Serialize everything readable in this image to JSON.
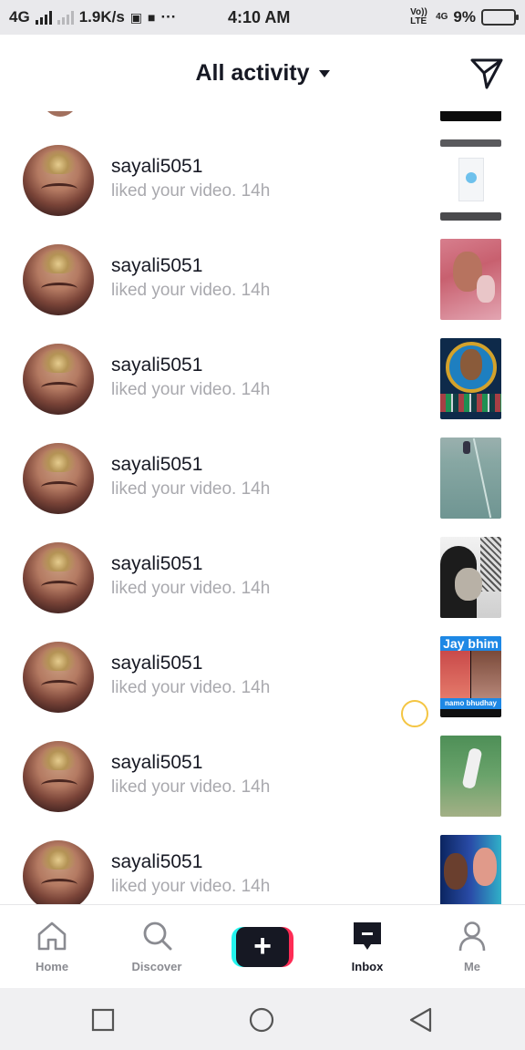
{
  "status_bar": {
    "network": "4G",
    "speed": "1.9K/s",
    "more": "···",
    "time": "4:10 AM",
    "volte": "Vo)) LTE",
    "net2": "4G",
    "battery": "9%",
    "battery_level": 0.09,
    "battery_color": "#e53935"
  },
  "header": {
    "title": "All activity",
    "filter_icon": "chevron-down-icon",
    "action_icon": "send-icon"
  },
  "notifications": [
    {
      "username": "sayali5051",
      "action": "liked your video.",
      "time": "14h"
    },
    {
      "username": "sayali5051",
      "action": "liked your video.",
      "time": "14h"
    },
    {
      "username": "sayali5051",
      "action": "liked your video.",
      "time": "14h"
    },
    {
      "username": "sayali5051",
      "action": "liked your video.",
      "time": "14h"
    },
    {
      "username": "sayali5051",
      "action": "liked your video.",
      "time": "14h"
    },
    {
      "username": "sayali5051",
      "action": "liked your video.",
      "time": "14h"
    },
    {
      "username": "sayali5051",
      "action": "liked your video.",
      "time": "14h"
    },
    {
      "username": "sayali5051",
      "action": "liked your video.",
      "time": "14h"
    }
  ],
  "thumb_text": {
    "jay_bhim": "Jay bhim",
    "namo": "namo bhudhay"
  },
  "bottom_nav": {
    "home": "Home",
    "discover": "Discover",
    "create": "+",
    "inbox": "Inbox",
    "me": "Me",
    "active": "inbox"
  },
  "colors": {
    "accent_cyan": "#25f4ee",
    "accent_pink": "#fe2c55",
    "text_primary": "#161823",
    "text_secondary": "#a9a9ae"
  }
}
